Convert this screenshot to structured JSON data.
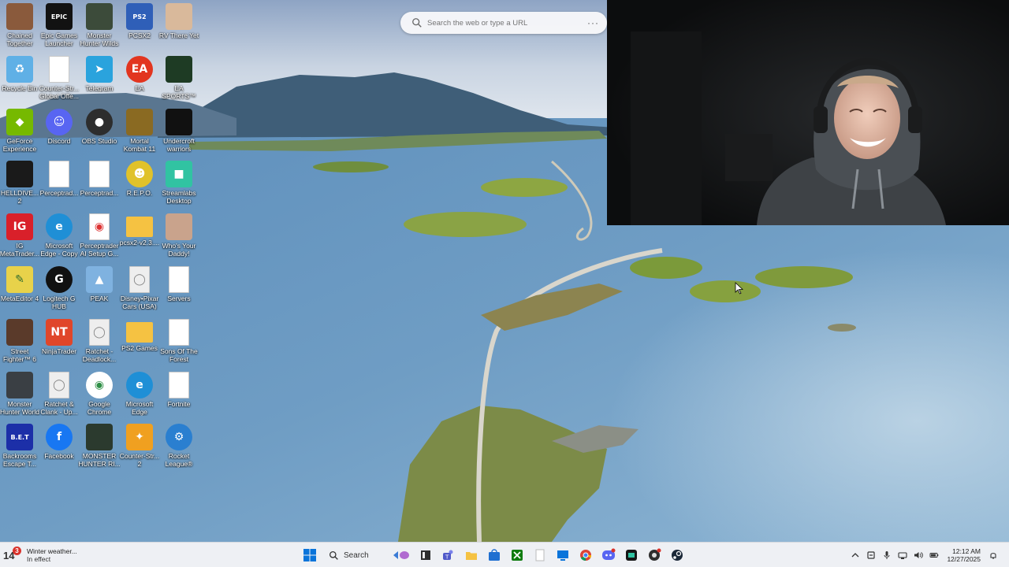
{
  "desktop": {
    "icons": [
      {
        "label": "Chained Together",
        "icon": "chained-together-icon",
        "color": "#8a5a3c"
      },
      {
        "label": "Epic Games Launcher",
        "icon": "epic-games-icon",
        "color": "#121212"
      },
      {
        "label": "Monster Hunter Wilds",
        "icon": "monster-hunter-wilds-icon",
        "color": "#3c4b3a"
      },
      {
        "label": "PCSX2",
        "icon": "pcsx2-icon",
        "color": "#2f5fb8"
      },
      {
        "label": "RV There Yet",
        "icon": "rv-there-yet-icon",
        "color": "#d9b99b"
      },
      {
        "label": "Recycle Bin",
        "icon": "recycle-bin-icon",
        "color": "#5fb0e6"
      },
      {
        "label": "Counter-Str... Global Offe...",
        "icon": "document-icon",
        "color": "#ffffff"
      },
      {
        "label": "Telegram",
        "icon": "telegram-icon",
        "color": "#2aa3dd"
      },
      {
        "label": "EA",
        "icon": "ea-icon",
        "color": "#e2351f"
      },
      {
        "label": "EA SPORTS™ Madden N...",
        "icon": "madden-icon",
        "color": "#1e3b24"
      },
      {
        "label": "GeForce Experience",
        "icon": "geforce-icon",
        "color": "#76b900"
      },
      {
        "label": "Discord",
        "icon": "discord-icon",
        "color": "#5865f2"
      },
      {
        "label": "OBS Studio",
        "icon": "obs-icon",
        "color": "#2d2d2d"
      },
      {
        "label": "Mortal Kombat 11",
        "icon": "mortal-kombat-icon",
        "color": "#8a6a22"
      },
      {
        "label": "Undercroft warriors",
        "icon": "undercroft-icon",
        "color": "#111111"
      },
      {
        "label": "HELLDIVE... 2",
        "icon": "helldivers-icon",
        "color": "#1a1a1a"
      },
      {
        "label": "Perceptrad...",
        "icon": "document-icon",
        "color": "#ffffff"
      },
      {
        "label": "Perceptrad...",
        "icon": "document-icon",
        "color": "#ffffff"
      },
      {
        "label": "R.E.P.O.",
        "icon": "repo-icon",
        "color": "#e0c22a"
      },
      {
        "label": "Streamlabs Desktop",
        "icon": "streamlabs-icon",
        "color": "#31c3a2"
      },
      {
        "label": "IG MetaTrader...",
        "icon": "ig-metatrader-icon",
        "color": "#d9202a"
      },
      {
        "label": "Microsoft Edge - Copy",
        "icon": "edge-icon",
        "color": "#1f8fd6"
      },
      {
        "label": "Perceptrader AI Setup G...",
        "icon": "chrome-doc-icon",
        "color": "#ffffff"
      },
      {
        "label": "pcsx2-v2.3....",
        "icon": "folder-icon",
        "color": "#f5c242"
      },
      {
        "label": "Who's Your Daddy!",
        "icon": "whos-your-daddy-icon",
        "color": "#c9a38c"
      },
      {
        "label": "MetaEditor 4",
        "icon": "metaeditor-icon",
        "color": "#e8d24a"
      },
      {
        "label": "Logitech G HUB",
        "icon": "logitech-icon",
        "color": "#111111"
      },
      {
        "label": "PEAK",
        "icon": "peak-icon",
        "color": "#7fb2e0"
      },
      {
        "label": "Disney•Pixar Cars (USA)",
        "icon": "disc-icon",
        "color": "#eeeeee"
      },
      {
        "label": "Servers",
        "icon": "document-icon",
        "color": "#ffffff"
      },
      {
        "label": "Street Fighter™ 6",
        "icon": "street-fighter-icon",
        "color": "#5a3a2a"
      },
      {
        "label": "NinjaTrader",
        "icon": "ninjatrader-icon",
        "color": "#e0462a"
      },
      {
        "label": "Ratchet - Deadlock...",
        "icon": "disc-icon",
        "color": "#eeeeee"
      },
      {
        "label": "PS2 Games",
        "icon": "folder-icon",
        "color": "#f5c242"
      },
      {
        "label": "Sons Of The Forest",
        "icon": "document-icon",
        "color": "#ffffff"
      },
      {
        "label": "Monster Hunter World",
        "icon": "monster-hunter-world-icon",
        "color": "#3a3f44"
      },
      {
        "label": "Ratchet & Clank - Up...",
        "icon": "disc-icon",
        "color": "#eeeeee"
      },
      {
        "label": "Google Chrome",
        "icon": "chrome-icon",
        "color": "#ffffff"
      },
      {
        "label": "Microsoft Edge",
        "icon": "edge-icon",
        "color": "#1f8fd6"
      },
      {
        "label": "Fortnite",
        "icon": "document-icon",
        "color": "#ffffff"
      },
      {
        "label": "Backrooms Escape T...",
        "icon": "backrooms-icon",
        "color": "#1c2fa8"
      },
      {
        "label": "Facebook",
        "icon": "facebook-icon",
        "color": "#1877f2"
      },
      {
        "label": "MONSTER HUNTER RI...",
        "icon": "monster-hunter-rise-icon",
        "color": "#2b3a2e"
      },
      {
        "label": "Counter-Str... 2",
        "icon": "counter-strike-2-icon",
        "color": "#f0a020"
      },
      {
        "label": "Rocket League®",
        "icon": "rocket-league-icon",
        "color": "#2a7fd0"
      }
    ]
  },
  "browser_search": {
    "placeholder": "Search the web or type a URL",
    "icon": "search-icon",
    "more_icon": "more-options-icon"
  },
  "weather": {
    "temperature": "14",
    "badge": "3",
    "title": "Winter weather...",
    "subtitle": "In effect"
  },
  "taskbar": {
    "search_label": "Search",
    "apps": [
      {
        "name": "file-explorer-icon"
      },
      {
        "name": "teams-icon"
      },
      {
        "name": "folder-icon"
      },
      {
        "name": "microsoft-store-icon"
      },
      {
        "name": "xbox-icon"
      },
      {
        "name": "notepad-icon"
      },
      {
        "name": "remote-desktop-icon"
      },
      {
        "name": "chrome-icon"
      },
      {
        "name": "discord-icon"
      },
      {
        "name": "streamlabs-icon"
      },
      {
        "name": "obs-icon"
      },
      {
        "name": "steam-icon"
      }
    ]
  },
  "tray": {
    "time": "12:12 AM",
    "date": "12/27/2025"
  },
  "colors": {
    "taskbar_bg": "#eef0f4",
    "win_blue": "#0a74da"
  }
}
